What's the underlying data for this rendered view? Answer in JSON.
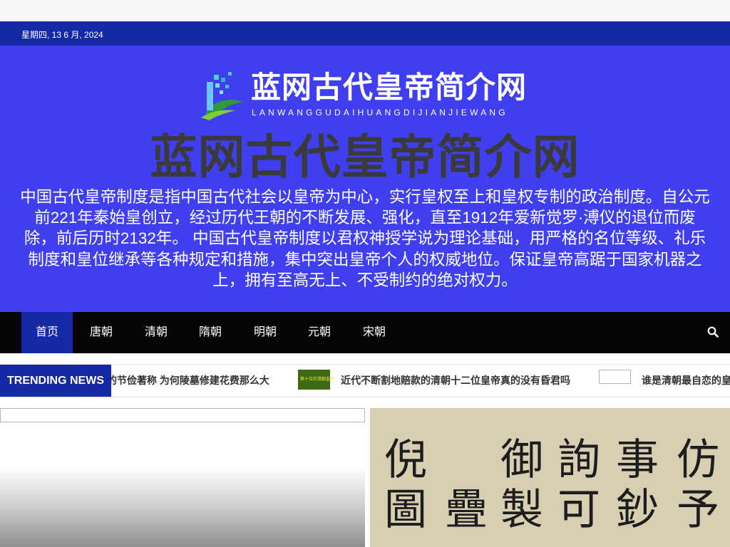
{
  "topbar": {
    "date": "星期四, 13 6 月, 2024"
  },
  "logo": {
    "title": "蓝网古代皇帝简介网",
    "subtitle": "LANWANGGUDAIHUANGDIJIANJIEWANG"
  },
  "site": {
    "title": "蓝网古代皇帝简介网",
    "description": "中国古代皇帝制度是指中国古代社会以皇帝为中心，实行皇权至上和皇权专制的政治制度。自公元前221年秦始皇创立，经过历代王朝的不断发展、强化，直至1912年爱新觉罗·溥仪的退位而废除，前后历时2132年。 中国古代皇帝制度以君权神授学说为理论基础，用严格的名位等级、礼乐制度和皇位继承等各种规定和措施，集中突出皇帝个人的权威地位。保证皇帝高踞于国家机器之上，拥有至高无上、不受制约的绝对权力。"
  },
  "nav": {
    "items": [
      {
        "label": "首页",
        "active": true
      },
      {
        "label": "唐朝"
      },
      {
        "label": "清朝"
      },
      {
        "label": "隋朝"
      },
      {
        "label": "明朝"
      },
      {
        "label": "元朝"
      },
      {
        "label": "宋朝"
      }
    ],
    "search_icon": "search-icon"
  },
  "trending": {
    "label": "TRENDING NEWS",
    "items": [
      {
        "title": "的节俭著称 为何陵墓修建花费那么大"
      },
      {
        "title": "近代不断割地赔款的清朝十二位皇帝真的没有昏君吗",
        "thumb_text": "第十位的清朝皇帝"
      },
      {
        "title": "谁是清朝最自恋的皇"
      }
    ]
  },
  "featured": {
    "right_calligraphy": [
      "仿",
      "事",
      "詢",
      "御",
      "倪",
      "予",
      "鈔",
      "可",
      "製",
      "疊",
      "圖"
    ]
  },
  "colors": {
    "topbar": "#1528a6",
    "header": "#3f3ff0",
    "nav": "#050505",
    "accent": "#1528a6"
  }
}
